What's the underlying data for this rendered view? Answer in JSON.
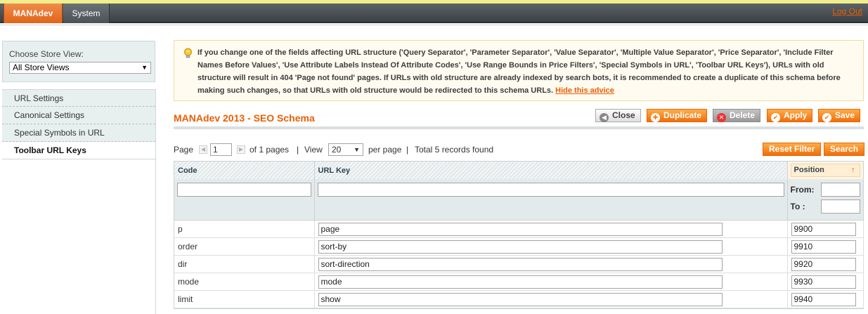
{
  "topnav": {
    "items": [
      {
        "label": "MANAdev",
        "active": true
      },
      {
        "label": "System",
        "active": false
      }
    ],
    "logout_label": "Log Out"
  },
  "sidebar": {
    "store_label": "Choose Store View:",
    "store_value": "All Store Views",
    "tabs": [
      {
        "label": "URL Settings",
        "active": false
      },
      {
        "label": "Canonical Settings",
        "active": false
      },
      {
        "label": "Special Symbols in URL",
        "active": false
      },
      {
        "label": "Toolbar URL Keys",
        "active": true
      }
    ]
  },
  "notice": {
    "text": "If you change one of the fields affecting URL structure ('Query Separator', 'Parameter Separator', 'Value Separator', 'Multiple Value Separator', 'Price Separator', 'Include Filter Names Before Values', 'Use Attribute Labels Instead Of Attribute Codes', 'Use Range Bounds in Price Filters', 'Special Symbols in URL', 'Toolbar URL Keys'), URLs with old structure will result in 404 'Page not found' pages. If URLs with old structure are already indexed by search bots, it is recommended to create a duplicate of this schema before making such changes, so that URLs with old structure would be redirected to this schema URLs.",
    "hide_link": "Hide this advice"
  },
  "page": {
    "title": "MANAdev 2013 - SEO Schema",
    "buttons": {
      "close": "Close",
      "duplicate": "Duplicate",
      "delete": "Delete",
      "apply": "Apply",
      "save": "Save"
    }
  },
  "pager": {
    "page_label": "Page",
    "page_value": "1",
    "of_pages": "of 1 pages",
    "sep1": "|",
    "view_label": "View",
    "per_page_value": "20",
    "per_page_label": "per page",
    "sep2": "|",
    "total": "Total 5 records found",
    "reset_filter": "Reset Filter",
    "search": "Search"
  },
  "grid": {
    "columns": {
      "code": "Code",
      "url_key": "URL Key",
      "position": "Position"
    },
    "filter": {
      "from_label": "From:",
      "to_label": "To :"
    },
    "rows": [
      {
        "code": "p",
        "url_key": "page",
        "position": "9900"
      },
      {
        "code": "order",
        "url_key": "sort-by",
        "position": "9910"
      },
      {
        "code": "dir",
        "url_key": "sort-direction",
        "position": "9920"
      },
      {
        "code": "mode",
        "url_key": "mode",
        "position": "9930"
      },
      {
        "code": "limit",
        "url_key": "show",
        "position": "9940"
      }
    ]
  },
  "colors": {
    "accent": "#eb5e00",
    "nav_bg": "#3b4144",
    "button_orange": "#f06e0a",
    "notice_bg": "#fffbf0",
    "sidebar_bg": "#e7efef"
  }
}
